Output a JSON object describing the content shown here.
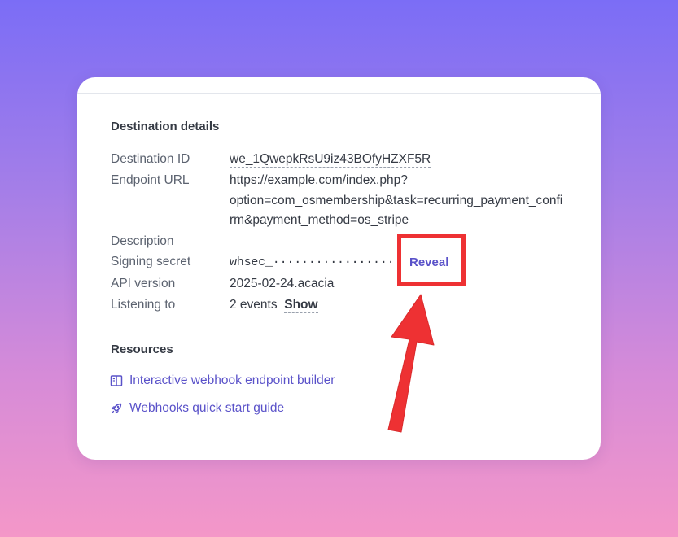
{
  "destination": {
    "heading": "Destination details",
    "fields": {
      "destination_id": {
        "label": "Destination ID",
        "value": "we_1QwepkRsU9iz43BOfyHZXF5R"
      },
      "endpoint_url": {
        "label": "Endpoint URL",
        "lines": [
          "https://example.com/index.php?",
          "option=com_osmembership&task=recurring_payment_confi",
          "rm&payment_method=os_stripe"
        ]
      },
      "description": {
        "label": "Description",
        "value": ""
      },
      "signing_secret": {
        "label": "Signing secret",
        "value": "whsec_·················",
        "reveal_label": "Reveal"
      },
      "api_version": {
        "label": "API version",
        "value": "2025-02-24.acacia"
      },
      "listening_to": {
        "label": "Listening to",
        "value": "2 events",
        "show_label": "Show"
      }
    }
  },
  "resources": {
    "heading": "Resources",
    "links": [
      {
        "label": "Interactive webhook endpoint builder",
        "icon": "book-icon"
      },
      {
        "label": "Webhooks quick start guide",
        "icon": "rocket-icon"
      }
    ]
  },
  "colors": {
    "accent": "#5a52c9",
    "highlight": "#ee3133",
    "background_top": "#7b6df6",
    "background_bottom": "#f497c8"
  }
}
